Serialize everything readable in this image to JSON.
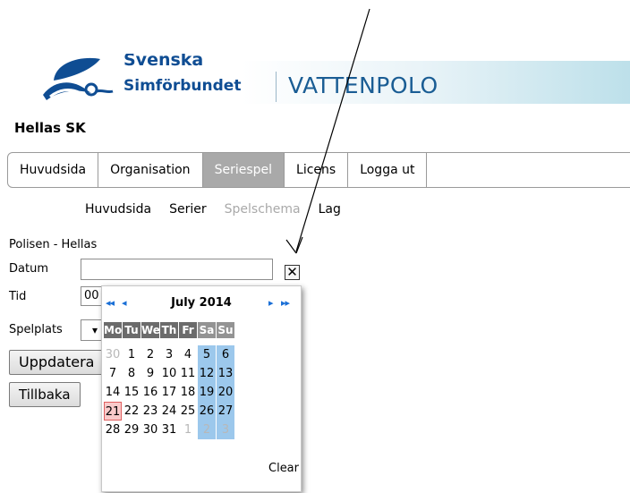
{
  "header": {
    "brand_line1": "Svenska",
    "brand_line2": "Simförbundet",
    "brand_sub": "VATTENPOLO"
  },
  "club": "Hellas SK",
  "tabs": [
    {
      "label": "Huvudsida",
      "active": false
    },
    {
      "label": "Organisation",
      "active": false
    },
    {
      "label": "Seriespel",
      "active": true
    },
    {
      "label": "Licens",
      "active": false
    },
    {
      "label": "Logga ut",
      "active": false
    }
  ],
  "subnav": [
    {
      "label": "Huvudsida",
      "active": false
    },
    {
      "label": "Serier",
      "active": false
    },
    {
      "label": "Spelschema",
      "active": true
    },
    {
      "label": "Lag",
      "active": false
    }
  ],
  "form": {
    "match_title": "Polisen - Hellas",
    "datum_label": "Datum",
    "datum_value": "",
    "tid_label": "Tid",
    "tid_value": "00",
    "spelplats_label": "Spelplats",
    "update_button": "Uppdatera",
    "back_button": "Tillbaka",
    "clear_glyph": "✕"
  },
  "calendar": {
    "month_label": "July 2014",
    "nav_prev_year": "◂◂",
    "nav_prev_month": "◂",
    "nav_next_month": "▸",
    "nav_next_year": "▸▸",
    "weekdays": [
      "Mo",
      "Tu",
      "We",
      "Th",
      "Fr",
      "Sa",
      "Su"
    ],
    "weeks": [
      [
        "30",
        "1",
        "2",
        "3",
        "4",
        "5",
        "6"
      ],
      [
        "7",
        "8",
        "9",
        "10",
        "11",
        "12",
        "13"
      ],
      [
        "14",
        "15",
        "16",
        "17",
        "18",
        "19",
        "20"
      ],
      [
        "21",
        "22",
        "23",
        "24",
        "25",
        "26",
        "27"
      ],
      [
        "28",
        "29",
        "30",
        "31",
        "1",
        "2",
        "3"
      ]
    ],
    "today": "21",
    "clear_label": "Clear"
  },
  "colors": {
    "brand_blue": "#0f4d93",
    "weekend_highlight": "#9cc8ec",
    "today_highlight": "#f9caca",
    "active_tab": "#a9a9a9"
  }
}
